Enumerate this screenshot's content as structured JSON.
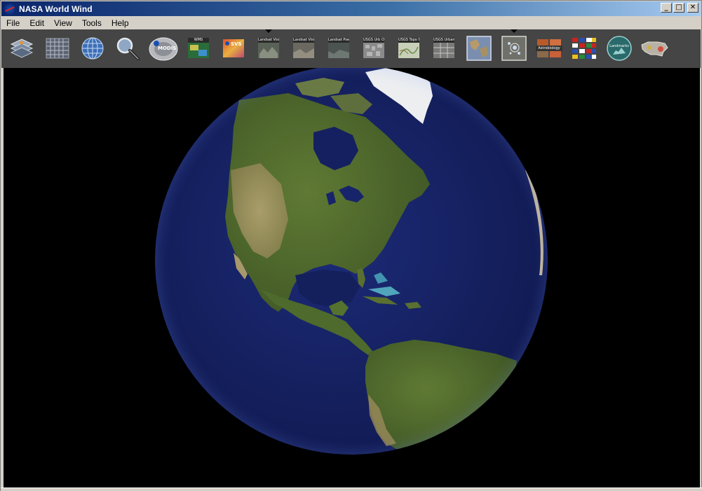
{
  "window": {
    "title": "NASA World Wind"
  },
  "title_buttons": {
    "minimize": "_",
    "maximize": "□",
    "close": "✕"
  },
  "menu": [
    {
      "label": "File"
    },
    {
      "label": "Edit"
    },
    {
      "label": "View"
    },
    {
      "label": "Tools"
    },
    {
      "label": "Help"
    }
  ],
  "toolbar": {
    "tools": [
      {
        "id": "layer-manager",
        "icon": "layers-icon",
        "label": ""
      },
      {
        "id": "lat-lon-grid",
        "icon": "grid-icon",
        "label": ""
      },
      {
        "id": "place-names",
        "icon": "globe-wire-icon",
        "label": ""
      },
      {
        "id": "search",
        "icon": "magnifier-icon",
        "label": ""
      },
      {
        "id": "modis",
        "icon": "modis-icon",
        "label": "MODIS"
      },
      {
        "id": "wms-browser",
        "icon": "wms-icon",
        "label": "WMS"
      },
      {
        "id": "svs",
        "icon": "svs-icon",
        "label": "SVS"
      },
      {
        "id": "landsat-visible",
        "icon": "landsat-icon",
        "label": "Landsat Visible"
      },
      {
        "id": "landsat-visible-2",
        "icon": "landsat-icon",
        "label": "Landsat Visible"
      },
      {
        "id": "landsat-pseudo",
        "icon": "landsat-icon",
        "label": "Landsat Pseudo"
      },
      {
        "id": "usgs-topo-ortho",
        "icon": "usgs-icon",
        "label": "USGS Urb Ortho"
      },
      {
        "id": "usgs-topo-map",
        "icon": "usgs-icon",
        "label": "USGS Topo Map"
      },
      {
        "id": "usgs-urban-area",
        "icon": "usgs-icon",
        "label": "USGS Urban Area"
      },
      {
        "id": "blue-marble",
        "icon": "map-icon",
        "label": ""
      },
      {
        "id": "placemark",
        "icon": "satellite-icon",
        "label": ""
      },
      {
        "id": "astrobiology",
        "icon": "astro-icon",
        "label": "Astrobiology"
      },
      {
        "id": "flags",
        "icon": "flags-icon",
        "label": ""
      },
      {
        "id": "landmarks",
        "icon": "landmarks-icon",
        "label": "Landmarks"
      },
      {
        "id": "usa-map",
        "icon": "usa-map-icon",
        "label": ""
      }
    ],
    "active_arrows": [
      "landsat-visible",
      "placemark"
    ]
  },
  "colors": {
    "ocean": "#141f5c",
    "land_green": "#4f6a2c",
    "land_desert": "#a89a6a",
    "ice": "#f2f2f2"
  }
}
